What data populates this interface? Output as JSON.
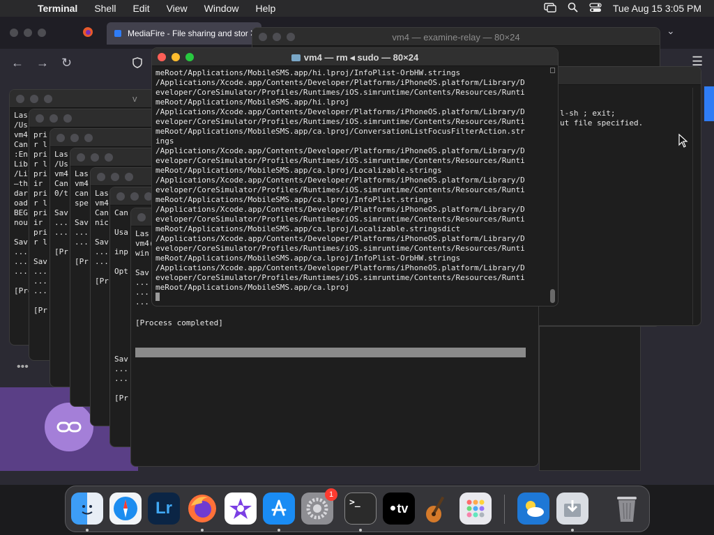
{
  "menubar": {
    "app": "Terminal",
    "items": [
      "Shell",
      "Edit",
      "View",
      "Window",
      "Help"
    ],
    "datetime": "Tue Aug 15  3:05 PM"
  },
  "browser": {
    "tab_title": "MediaFire - File sharing and stor"
  },
  "windows": {
    "relay_title": "vm4 — examine-relay — 80×24",
    "relay_lines": [
      "l-sh ; exit;",
      "ut file specified."
    ],
    "back_title_fragment": "v",
    "back_process": "[Process completed]",
    "stack_lines": [
      [
        "Las",
        "/Us",
        "vm4(",
        "Can",
        ":Enc",
        "Lib",
        "/Lil",
        "—thi",
        "dar",
        "oad:",
        "BEGI",
        "nour",
        "",
        "Sav",
        "...",
        "...",
        "...",
        "",
        "[Pro"
      ],
      [
        "pri",
        "r l",
        "pri",
        "r l",
        "pri",
        "ir",
        "pri",
        "r l",
        "pri",
        "ir",
        "pri",
        "r l",
        "",
        "Sav",
        "...",
        "...",
        "...",
        "",
        "[Pr"
      ],
      [
        "Las",
        "/Us",
        "vm4(",
        "Can",
        "0/t",
        "",
        "Sav",
        "...",
        "...",
        "",
        "[Pr"
      ],
      [
        "Las",
        "vm4(",
        "can",
        "spe",
        "",
        "Sav",
        "...",
        "...",
        "",
        "[Pr"
      ],
      [
        "Las",
        "vm4(",
        "Can",
        "nic",
        "",
        "Sav",
        "...",
        "...",
        "",
        "[Pr"
      ],
      [
        "Can",
        "",
        "Usa",
        "",
        "inp",
        "",
        "Opt",
        "",
        "",
        "",
        "",
        "",
        "",
        "",
        "",
        "Sav",
        "...",
        "...",
        "",
        "[Pr"
      ],
      [
        "Las",
        "vm4(",
        "win",
        "",
        "Sav",
        "...",
        "...",
        "..."
      ]
    ]
  },
  "main_terminal": {
    "title": "vm4 — rm ◂ sudo — 80×24",
    "lines": [
      "meRoot/Applications/MobileSMS.app/hi.lproj/InfoPlist-OrbHW.strings",
      "/Applications/Xcode.app/Contents/Developer/Platforms/iPhoneOS.platform/Library/D",
      "eveloper/CoreSimulator/Profiles/Runtimes/iOS.simruntime/Contents/Resources/Runti",
      "meRoot/Applications/MobileSMS.app/hi.lproj",
      "/Applications/Xcode.app/Contents/Developer/Platforms/iPhoneOS.platform/Library/D",
      "eveloper/CoreSimulator/Profiles/Runtimes/iOS.simruntime/Contents/Resources/Runti",
      "meRoot/Applications/MobileSMS.app/ca.lproj/ConversationListFocusFilterAction.str",
      "ings",
      "/Applications/Xcode.app/Contents/Developer/Platforms/iPhoneOS.platform/Library/D",
      "eveloper/CoreSimulator/Profiles/Runtimes/iOS.simruntime/Contents/Resources/Runti",
      "meRoot/Applications/MobileSMS.app/ca.lproj/Localizable.strings",
      "/Applications/Xcode.app/Contents/Developer/Platforms/iPhoneOS.platform/Library/D",
      "eveloper/CoreSimulator/Profiles/Runtimes/iOS.simruntime/Contents/Resources/Runti",
      "meRoot/Applications/MobileSMS.app/ca.lproj/InfoPlist.strings",
      "/Applications/Xcode.app/Contents/Developer/Platforms/iPhoneOS.platform/Library/D",
      "eveloper/CoreSimulator/Profiles/Runtimes/iOS.simruntime/Contents/Resources/Runti",
      "meRoot/Applications/MobileSMS.app/ca.lproj/Localizable.stringsdict",
      "/Applications/Xcode.app/Contents/Developer/Platforms/iPhoneOS.platform/Library/D",
      "eveloper/CoreSimulator/Profiles/Runtimes/iOS.simruntime/Contents/Resources/Runti",
      "meRoot/Applications/MobileSMS.app/ca.lproj/InfoPlist-OrbHW.strings",
      "/Applications/Xcode.app/Contents/Developer/Platforms/iPhoneOS.platform/Library/D",
      "eveloper/CoreSimulator/Profiles/Runtimes/iOS.simruntime/Contents/Resources/Runti",
      "meRoot/Applications/MobileSMS.app/ca.lproj"
    ]
  },
  "dock": {
    "lightroom_label": "Lr",
    "settings_badge": "1",
    "terminal_glyph": ">_",
    "appletv_label": "tv"
  },
  "colors": {
    "close": "#ff5f57",
    "minimize": "#febc2e",
    "zoom": "#28c840"
  }
}
